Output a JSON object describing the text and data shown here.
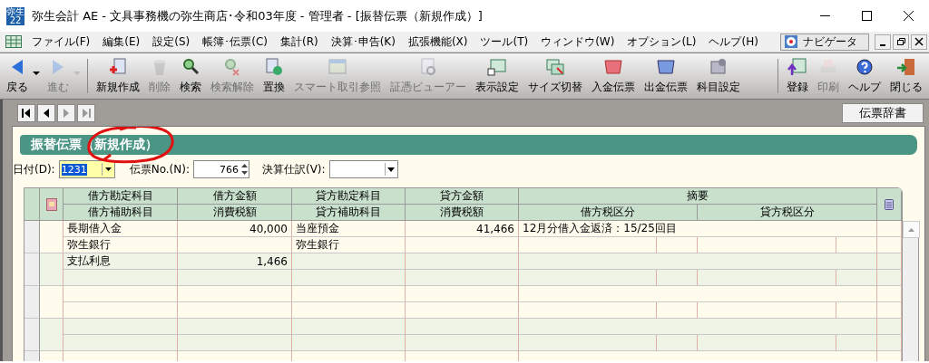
{
  "window": {
    "icon_label": [
      "弥生",
      "22"
    ],
    "title": "弥生会計 AE - 文具事務機の弥生商店･令和03年度 - 管理者 - [振替伝票（新規作成）]"
  },
  "menu": {
    "items": [
      "ファイル(F)",
      "編集(E)",
      "設定(S)",
      "帳簿･伝票(C)",
      "集計(R)",
      "決算･申告(K)",
      "拡張機能(X)",
      "ツール(T)",
      "ウィンドウ(W)",
      "オプション(L)",
      "ヘルプ(H)"
    ],
    "navigator": "ナビゲータ"
  },
  "toolbar": {
    "left_items": [
      {
        "kind": "back",
        "label": "戻る",
        "disabled": false,
        "dropdown": true
      },
      {
        "kind": "forward",
        "label": "進む",
        "disabled": true,
        "dropdown": true
      },
      {
        "kind": "new",
        "label": "新規作成",
        "disabled": false,
        "dropdown": false
      },
      {
        "kind": "delete",
        "label": "削除",
        "disabled": true,
        "dropdown": false
      },
      {
        "kind": "search",
        "label": "検索",
        "disabled": false,
        "dropdown": false
      },
      {
        "kind": "clear",
        "label": "検索解除",
        "disabled": true,
        "dropdown": false
      },
      {
        "kind": "replace",
        "label": "置換",
        "disabled": false,
        "dropdown": false
      },
      {
        "kind": "window",
        "label": "スマート取引参照",
        "disabled": true,
        "dropdown": false
      },
      {
        "kind": "viewer",
        "label": "証憑ビューアー",
        "disabled": true,
        "dropdown": false
      },
      {
        "kind": "settings",
        "label": "表示設定",
        "disabled": false,
        "dropdown": false
      },
      {
        "kind": "resize",
        "label": "サイズ切替",
        "disabled": false,
        "dropdown": false
      },
      {
        "kind": "in",
        "label": "入金伝票",
        "disabled": false,
        "dropdown": false
      },
      {
        "kind": "out",
        "label": "出金伝票",
        "disabled": false,
        "dropdown": false
      },
      {
        "kind": "accounts",
        "label": "科目設定",
        "disabled": false,
        "dropdown": false
      }
    ],
    "right_items": [
      {
        "kind": "save",
        "label": "登録",
        "disabled": false,
        "dropdown": false
      },
      {
        "kind": "print",
        "label": "印刷",
        "disabled": true,
        "dropdown": false
      },
      {
        "kind": "help",
        "label": "ヘルプ",
        "disabled": false,
        "dropdown": false
      },
      {
        "kind": "close",
        "label": "閉じる",
        "disabled": false,
        "dropdown": false
      }
    ]
  },
  "record_nav": [
    {
      "kind": "first",
      "disabled": false
    },
    {
      "kind": "prev",
      "disabled": false
    },
    {
      "kind": "next",
      "disabled": true
    },
    {
      "kind": "last",
      "disabled": true
    }
  ],
  "dictionary_button": "伝票辞書",
  "form": {
    "title": "振替伝票（新規作成）",
    "date": {
      "label": "日付(D):",
      "value": "1231"
    },
    "voucher_no": {
      "label": "伝票No.(N):",
      "value": "766"
    },
    "closing_entry": {
      "label": "決算仕訳(V):"
    }
  },
  "grid": {
    "header_top": [
      "借方勘定科目",
      "借方金額",
      "貸方勘定科目",
      "貸方金額",
      "摘要"
    ],
    "header_bottom": [
      "借方補助科目",
      "消費税額",
      "貸方補助科目",
      "消費税額",
      "借方税区分",
      "貸方税区分"
    ],
    "entries": [
      {
        "debit_account": "長期借入金",
        "debit_amount": "40,000",
        "credit_account": "当座預金",
        "credit_amount": "41,466",
        "description": "12月分借入金返済：15/25回目",
        "debit_sub": "弥生銀行",
        "credit_sub": "弥生銀行"
      },
      {
        "debit_account": "支払利息",
        "debit_amount": "1,466"
      }
    ]
  }
}
